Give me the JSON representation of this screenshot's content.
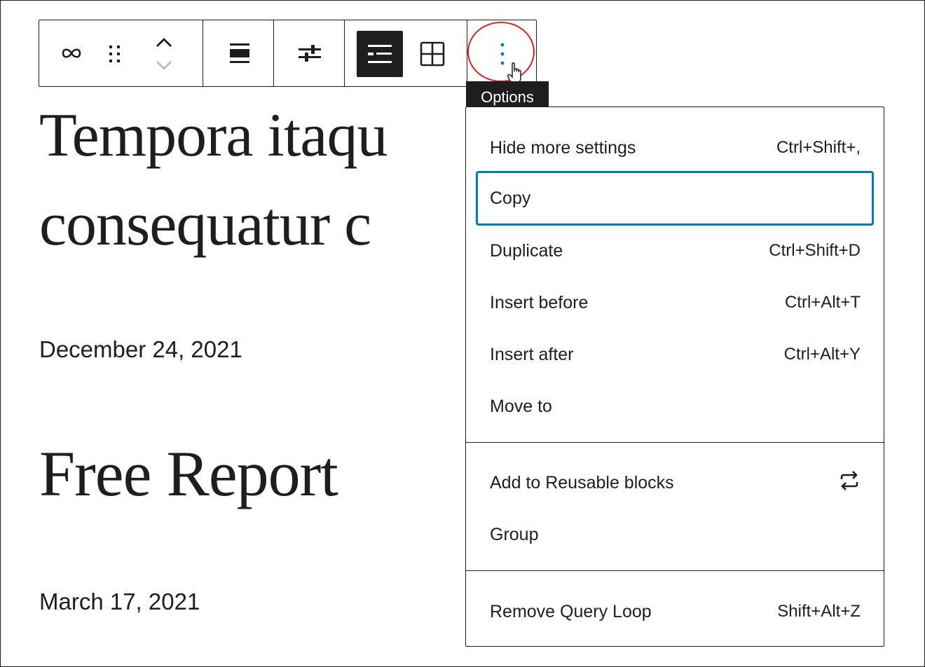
{
  "toolbar": {
    "buttons": [
      {
        "name": "link-icon"
      },
      {
        "name": "drag-handle-icon"
      },
      {
        "name": "move-up-icon"
      },
      {
        "name": "move-down-icon"
      },
      {
        "name": "align-full-icon"
      },
      {
        "name": "settings-sliders-icon"
      },
      {
        "name": "list-view-icon"
      },
      {
        "name": "grid-view-icon"
      },
      {
        "name": "more-options-icon"
      }
    ],
    "tooltip": "Options"
  },
  "content": {
    "post1_title_line1": "Tempora itaqu",
    "post1_title_line2": "consequatur c",
    "post1_date": "December 24, 2021",
    "post2_title": "Free Report",
    "post2_date": "March 17, 2021"
  },
  "menu": {
    "group1": [
      {
        "label": "Hide more settings",
        "shortcut": "Ctrl+Shift+,"
      },
      {
        "label": "Copy",
        "shortcut": ""
      },
      {
        "label": "Duplicate",
        "shortcut": "Ctrl+Shift+D"
      },
      {
        "label": "Insert before",
        "shortcut": "Ctrl+Alt+T"
      },
      {
        "label": "Insert after",
        "shortcut": "Ctrl+Alt+Y"
      },
      {
        "label": "Move to",
        "shortcut": ""
      }
    ],
    "group2": [
      {
        "label": "Add to Reusable blocks",
        "icon": "reusable-block-icon"
      },
      {
        "label": "Group"
      }
    ],
    "group3": [
      {
        "label": "Remove Query Loop",
        "shortcut": "Shift+Alt+Z"
      }
    ]
  },
  "colors": {
    "focus": "#007cba",
    "highlight": "#e01f1f",
    "dark": "#1e1e1e"
  }
}
